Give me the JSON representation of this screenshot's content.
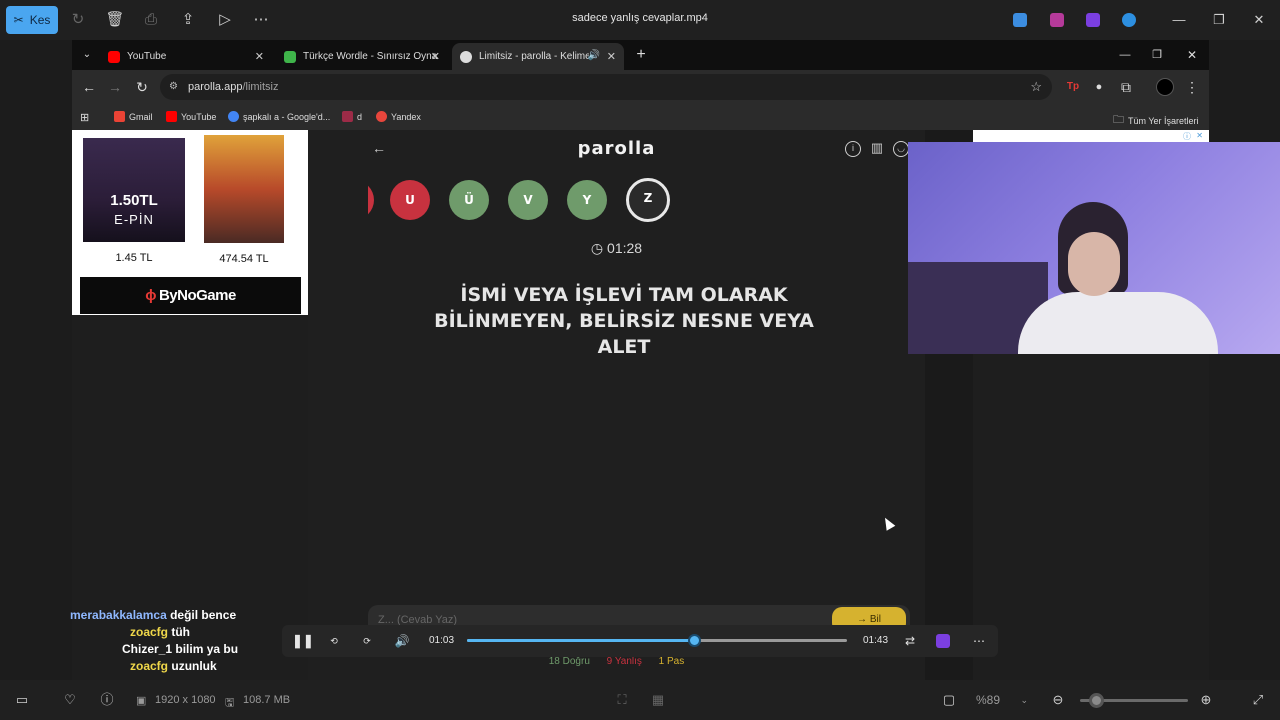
{
  "app": {
    "title": "sadece yanlış cevaplar.mp4",
    "kes_label": "Kes",
    "accent": "#4aa6f0"
  },
  "browser": {
    "tabs": [
      {
        "label": "YouTube",
        "icon": "youtube-icon",
        "color": "#ff0000"
      },
      {
        "label": "Türkçe Wordle - Sınırsız Oyna",
        "icon": "wordle-icon",
        "color": "#3fb44a"
      },
      {
        "label": "Limitsiz - parolla - Kelime o",
        "icon": "parolla-icon",
        "color": "#dddddd"
      }
    ],
    "new_tab": "+",
    "url_host": "parolla.app",
    "url_path": "/limitsiz",
    "bookmarks": [
      {
        "label": "Gmail",
        "color": "#ea4335"
      },
      {
        "label": "YouTube",
        "color": "#ff0000"
      },
      {
        "label": "şapkalı a - Google'd...",
        "color": "#4285f4"
      },
      {
        "label": "d",
        "color": "#9c2b47"
      },
      {
        "label": "Yandex",
        "color": "#e8463c"
      }
    ],
    "all_bookmarks": "Tüm Yer İşaretleri"
  },
  "ad": {
    "products": [
      {
        "badge": "1.50TL",
        "badge_sub": "E-PİN",
        "price": "1.45 TL"
      },
      {
        "price": "474.54 TL"
      }
    ],
    "brand": "ByNoGame"
  },
  "game": {
    "logo": "parolla",
    "letters": [
      {
        "char": "U",
        "state": "wrong"
      },
      {
        "char": "Ü",
        "state": "correct"
      },
      {
        "char": "V",
        "state": "correct"
      },
      {
        "char": "Y",
        "state": "correct"
      },
      {
        "char": "Z",
        "state": "current"
      }
    ],
    "timer": "01:28",
    "question": "İSMİ VEYA İŞLEVİ TAM OLARAK BİLİNMEYEN, BELİRSİZ NESNE VEYA ALET",
    "answer_placeholder": "Z... (Cevab Yaz)",
    "answer_button": "→ Bil",
    "stats": {
      "correct": "18 Doğru",
      "wrong": "9 Yanlış",
      "pass": "1 Pas",
      "correct_color": "#6f9b6b",
      "wrong_color": "#c8323f",
      "pass_color": "#d6b22f"
    }
  },
  "chat": [
    {
      "user": "merabakkalamca",
      "msg": "değil bence",
      "color": "#8fb8ff"
    },
    {
      "user": "zoacfg",
      "msg": "tüh",
      "color": "#f0d84a"
    },
    {
      "user": "Chizer_1",
      "msg": "bilim ya bu",
      "color": "#ffffff"
    },
    {
      "user": "zoacfg",
      "msg": "uzunluk",
      "color": "#f0d84a"
    }
  ],
  "player": {
    "current": "01:03",
    "total": "01:43",
    "progress": 0.6
  },
  "statusbar": {
    "resolution": "1920 x 1080",
    "size": "108.7 MB",
    "zoom": "%89",
    "zoom_level": 0.15
  }
}
